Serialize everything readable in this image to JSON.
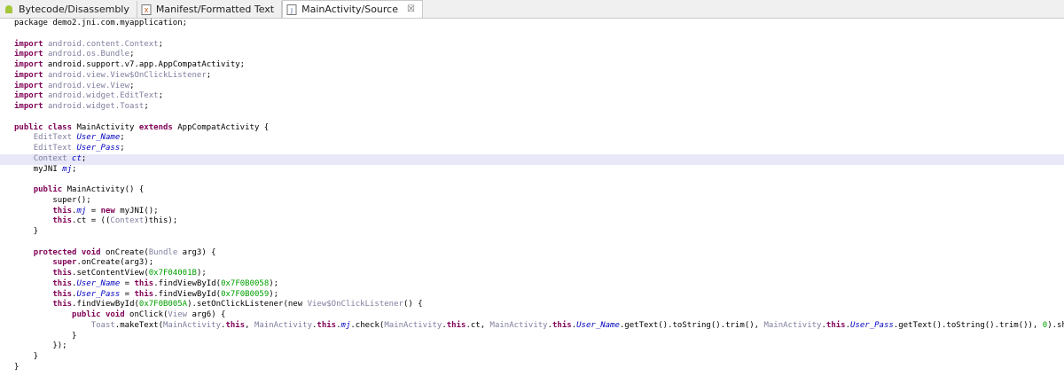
{
  "tabs": [
    {
      "label": "Bytecode/Disassembly",
      "icon": "android-icon"
    },
    {
      "label": "Manifest/Formatted Text",
      "icon": "xml-file-icon"
    },
    {
      "label": "MainActivity/Source",
      "icon": "java-file-icon",
      "close": "☒"
    }
  ],
  "code": [
    [
      {
        "t": "package demo2.jni.com.myapplication;",
        "c": "pln"
      }
    ],
    [],
    [
      {
        "t": "import",
        "c": "kw"
      },
      {
        "t": " ",
        "c": "pln"
      },
      {
        "t": "android.content.Context",
        "c": "pkg"
      },
      {
        "t": ";",
        "c": "pln"
      }
    ],
    [
      {
        "t": "import",
        "c": "kw"
      },
      {
        "t": " ",
        "c": "pln"
      },
      {
        "t": "android.os.Bundle",
        "c": "pkg"
      },
      {
        "t": ";",
        "c": "pln"
      }
    ],
    [
      {
        "t": "import",
        "c": "kw"
      },
      {
        "t": " android.support.v7.app.AppCompatActivity;",
        "c": "pln"
      }
    ],
    [
      {
        "t": "import",
        "c": "kw"
      },
      {
        "t": " ",
        "c": "pln"
      },
      {
        "t": "android.view.View$OnClickListener",
        "c": "pkg"
      },
      {
        "t": ";",
        "c": "pln"
      }
    ],
    [
      {
        "t": "import",
        "c": "kw"
      },
      {
        "t": " ",
        "c": "pln"
      },
      {
        "t": "android.view.View",
        "c": "pkg"
      },
      {
        "t": ";",
        "c": "pln"
      }
    ],
    [
      {
        "t": "import",
        "c": "kw"
      },
      {
        "t": " ",
        "c": "pln"
      },
      {
        "t": "android.widget.EditText",
        "c": "pkg"
      },
      {
        "t": ";",
        "c": "pln"
      }
    ],
    [
      {
        "t": "import",
        "c": "kw"
      },
      {
        "t": " ",
        "c": "pln"
      },
      {
        "t": "android.widget.Toast",
        "c": "pkg"
      },
      {
        "t": ";",
        "c": "pln"
      }
    ],
    [],
    [
      {
        "t": "public class",
        "c": "kw"
      },
      {
        "t": " MainActivity ",
        "c": "pln"
      },
      {
        "t": "extends",
        "c": "kw"
      },
      {
        "t": " AppCompatActivity {",
        "c": "pln"
      }
    ],
    [
      {
        "t": "    ",
        "c": "pln"
      },
      {
        "t": "EditText",
        "c": "cls"
      },
      {
        "t": " ",
        "c": "pln"
      },
      {
        "t": "User_Name",
        "c": "fld"
      },
      {
        "t": ";",
        "c": "pln"
      }
    ],
    [
      {
        "t": "    ",
        "c": "pln"
      },
      {
        "t": "EditText",
        "c": "cls"
      },
      {
        "t": " ",
        "c": "pln"
      },
      {
        "t": "User_Pass",
        "c": "fld"
      },
      {
        "t": ";",
        "c": "pln"
      }
    ],
    [
      {
        "t": "    ",
        "c": "pln"
      },
      {
        "t": "Context",
        "c": "cls"
      },
      {
        "t": " ",
        "c": "pln"
      },
      {
        "t": "ct",
        "c": "fld"
      },
      {
        "t": ";",
        "c": "pln"
      }
    ],
    [
      {
        "t": "    myJNI ",
        "c": "pln"
      },
      {
        "t": "mj",
        "c": "fld"
      },
      {
        "t": ";",
        "c": "pln"
      }
    ],
    [],
    [
      {
        "t": "    ",
        "c": "pln"
      },
      {
        "t": "public",
        "c": "kw"
      },
      {
        "t": " MainActivity() {",
        "c": "pln"
      }
    ],
    [
      {
        "t": "        super();",
        "c": "pln"
      }
    ],
    [
      {
        "t": "        ",
        "c": "pln"
      },
      {
        "t": "this",
        "c": "kw"
      },
      {
        "t": ".",
        "c": "pln"
      },
      {
        "t": "mj",
        "c": "fld"
      },
      {
        "t": " = ",
        "c": "pln"
      },
      {
        "t": "new",
        "c": "kw"
      },
      {
        "t": " myJNI();",
        "c": "pln"
      }
    ],
    [
      {
        "t": "        ",
        "c": "pln"
      },
      {
        "t": "this",
        "c": "kw"
      },
      {
        "t": ".ct = ((",
        "c": "pln"
      },
      {
        "t": "Context",
        "c": "cls"
      },
      {
        "t": ")this);",
        "c": "pln"
      }
    ],
    [
      {
        "t": "    }",
        "c": "pln"
      }
    ],
    [],
    [
      {
        "t": "    ",
        "c": "pln"
      },
      {
        "t": "protected void",
        "c": "kw"
      },
      {
        "t": " onCreate(",
        "c": "pln"
      },
      {
        "t": "Bundle",
        "c": "cls"
      },
      {
        "t": " arg3) {",
        "c": "pln"
      }
    ],
    [
      {
        "t": "        ",
        "c": "pln"
      },
      {
        "t": "super",
        "c": "kw"
      },
      {
        "t": ".onCreate(arg3);",
        "c": "pln"
      }
    ],
    [
      {
        "t": "        ",
        "c": "pln"
      },
      {
        "t": "this",
        "c": "kw"
      },
      {
        "t": ".setContentView(",
        "c": "pln"
      },
      {
        "t": "0x7F04001B",
        "c": "num"
      },
      {
        "t": ");",
        "c": "pln"
      }
    ],
    [
      {
        "t": "        ",
        "c": "pln"
      },
      {
        "t": "this",
        "c": "kw"
      },
      {
        "t": ".",
        "c": "pln"
      },
      {
        "t": "User_Name",
        "c": "fld"
      },
      {
        "t": " = ",
        "c": "pln"
      },
      {
        "t": "this",
        "c": "kw"
      },
      {
        "t": ".findViewById(",
        "c": "pln"
      },
      {
        "t": "0x7F0B0058",
        "c": "num"
      },
      {
        "t": ");",
        "c": "pln"
      }
    ],
    [
      {
        "t": "        ",
        "c": "pln"
      },
      {
        "t": "this",
        "c": "kw"
      },
      {
        "t": ".",
        "c": "pln"
      },
      {
        "t": "User_Pass",
        "c": "fld"
      },
      {
        "t": " = ",
        "c": "pln"
      },
      {
        "t": "this",
        "c": "kw"
      },
      {
        "t": ".findViewById(",
        "c": "pln"
      },
      {
        "t": "0x7F0B0059",
        "c": "num"
      },
      {
        "t": ");",
        "c": "pln"
      }
    ],
    [
      {
        "t": "        ",
        "c": "pln"
      },
      {
        "t": "this",
        "c": "kw"
      },
      {
        "t": ".findViewById(",
        "c": "pln"
      },
      {
        "t": "0x7F0B005A",
        "c": "num"
      },
      {
        "t": ").setOnClickListener(new ",
        "c": "pln"
      },
      {
        "t": "View$OnClickListener",
        "c": "cls"
      },
      {
        "t": "() {",
        "c": "pln"
      }
    ],
    [
      {
        "t": "            ",
        "c": "pln"
      },
      {
        "t": "public void",
        "c": "kw"
      },
      {
        "t": " onClick(",
        "c": "pln"
      },
      {
        "t": "View",
        "c": "cls"
      },
      {
        "t": " arg6) {",
        "c": "pln"
      }
    ],
    [
      {
        "t": "                ",
        "c": "pln"
      },
      {
        "t": "Toast",
        "c": "cls"
      },
      {
        "t": ".makeText(",
        "c": "pln"
      },
      {
        "t": "MainActivity",
        "c": "cls"
      },
      {
        "t": ".",
        "c": "pln"
      },
      {
        "t": "this",
        "c": "kw"
      },
      {
        "t": ", ",
        "c": "pln"
      },
      {
        "t": "MainActivity",
        "c": "cls"
      },
      {
        "t": ".",
        "c": "pln"
      },
      {
        "t": "this",
        "c": "kw"
      },
      {
        "t": ".",
        "c": "pln"
      },
      {
        "t": "mj",
        "c": "fld"
      },
      {
        "t": ".check(",
        "c": "pln"
      },
      {
        "t": "MainActivity",
        "c": "cls"
      },
      {
        "t": ".",
        "c": "pln"
      },
      {
        "t": "this",
        "c": "kw"
      },
      {
        "t": ".ct, ",
        "c": "pln"
      },
      {
        "t": "MainActivity",
        "c": "cls"
      },
      {
        "t": ".",
        "c": "pln"
      },
      {
        "t": "this",
        "c": "kw"
      },
      {
        "t": ".",
        "c": "pln"
      },
      {
        "t": "User_Name",
        "c": "fld"
      },
      {
        "t": ".getText().toString().trim(), ",
        "c": "pln"
      },
      {
        "t": "MainActivity",
        "c": "cls"
      },
      {
        "t": ".",
        "c": "pln"
      },
      {
        "t": "this",
        "c": "kw"
      },
      {
        "t": ".",
        "c": "pln"
      },
      {
        "t": "User_Pass",
        "c": "fld"
      },
      {
        "t": ".getText().toString().trim()), ",
        "c": "pln"
      },
      {
        "t": "0",
        "c": "num"
      },
      {
        "t": ").show();",
        "c": "pln"
      }
    ],
    [
      {
        "t": "            }",
        "c": "pln"
      }
    ],
    [
      {
        "t": "        });",
        "c": "pln"
      }
    ],
    [
      {
        "t": "    }",
        "c": "pln"
      }
    ],
    [
      {
        "t": "}",
        "c": "pln"
      }
    ]
  ],
  "highlighted_line_index": 13
}
